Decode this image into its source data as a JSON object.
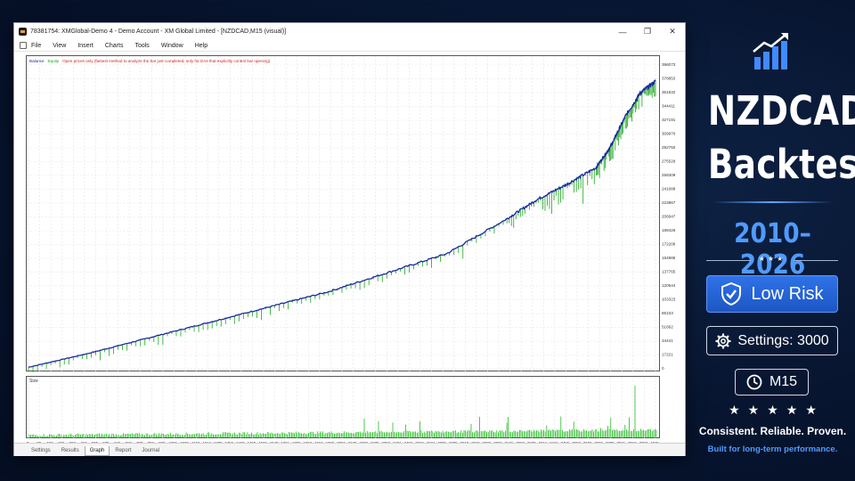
{
  "window": {
    "title": "78381754: XMGlobal-Demo 4 - Demo Account - XM Global Limited - [NZDCAD,M15 (visual)]",
    "controls": {
      "minimize": "—",
      "maximize": "❐",
      "close": "✕"
    }
  },
  "menu": {
    "items": [
      "File",
      "View",
      "Insert",
      "Charts",
      "Tools",
      "Window",
      "Help"
    ]
  },
  "chart_legend": {
    "balance": "Balance",
    "sep1": " / ",
    "equity": "Equity",
    "sep2": " / ",
    "note": "Open prices only (fastest method to analyze the bar just completed, only for EAs that explicitly control bar opening)"
  },
  "size_panel_label": "Size",
  "chart_data": {
    "type": "line",
    "series": [
      {
        "name": "Balance",
        "color": "#1a2a9a"
      },
      {
        "name": "Equity",
        "color": "#1aa61a"
      }
    ],
    "x": [
      0,
      400,
      800,
      1200,
      1600,
      2000,
      2400,
      2800,
      3200,
      3400,
      3600,
      3800,
      3900,
      4000,
      4100,
      4200
    ],
    "y": [
      2000,
      20000,
      40000,
      60000,
      80000,
      100000,
      125000,
      150000,
      195000,
      220000,
      240000,
      262000,
      290000,
      330000,
      360000,
      375000
    ],
    "y_ticks": [
      "396073",
      "378853",
      "361632",
      "344411",
      "327191",
      "309970",
      "292750",
      "275529",
      "258309",
      "241088",
      "223867",
      "206647",
      "189426",
      "172206",
      "154985",
      "137765",
      "120544",
      "103323",
      "86103",
      "51662",
      "34441",
      "17221",
      "0"
    ],
    "x_ticks": [
      "0",
      "80",
      "150",
      "222",
      "363",
      "434",
      "505",
      "575",
      "646",
      "717",
      "788",
      "859",
      "930",
      "1001",
      "1072",
      "1143",
      "1214",
      "1285",
      "1356",
      "1427",
      "1498",
      "1569",
      "1640",
      "1711",
      "1782",
      "1853",
      "1924",
      "1995",
      "2066",
      "2137",
      "2208",
      "2279",
      "2350",
      "2421",
      "2492",
      "2563",
      "2634",
      "2705",
      "2776",
      "2847",
      "2918",
      "2989",
      "3060",
      "3131",
      "3202",
      "3273",
      "3344",
      "3415",
      "3486",
      "3557",
      "3628",
      "3699",
      "3770",
      "3841",
      "3912",
      "3983",
      "4045"
    ],
    "ylim": [
      0,
      396073
    ],
    "grid": true
  },
  "tabs": {
    "items": [
      "Settings",
      "Results",
      "Graph",
      "Report",
      "Journal"
    ],
    "active": "Graph"
  },
  "promo": {
    "title_line1": "NZDCAD",
    "title_line2": "Backtest",
    "years": "2010–2026",
    "divider_stars": "★★★",
    "risk_label": "Low Risk",
    "settings_label": "Settings: 3000",
    "timeframe_label": "M15",
    "rating_stars": "★★★★★",
    "slogan": "Consistent. Reliable. Proven.",
    "sub_slogan": "Built for long-term performance.",
    "accent_color": "#4f9bff"
  }
}
